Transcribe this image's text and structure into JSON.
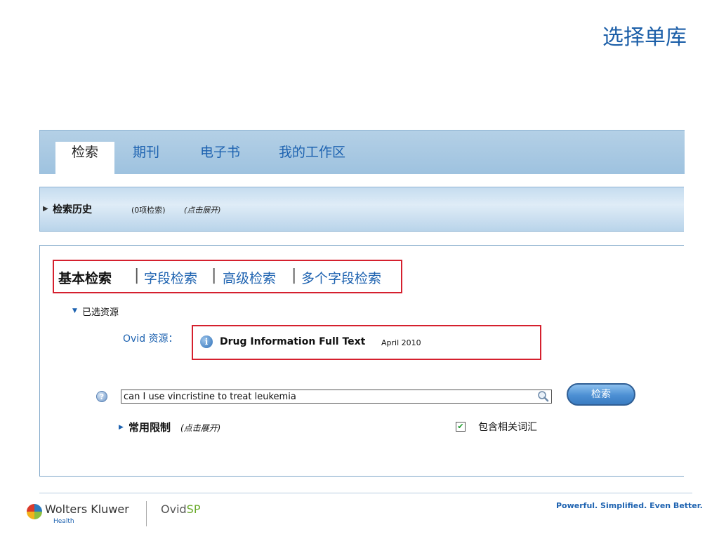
{
  "slide": {
    "title": "选择单库"
  },
  "nav": {
    "tabs": [
      {
        "label": "检索"
      },
      {
        "label": "期刊"
      },
      {
        "label": "电子书"
      },
      {
        "label": "我的工作区"
      }
    ]
  },
  "history": {
    "title": "检索历史",
    "count": "(0项检索)",
    "hint": "(点击展开)"
  },
  "search_modes": {
    "tabs": [
      {
        "label": "基本检索"
      },
      {
        "label": "字段检索"
      },
      {
        "label": "高级检索"
      },
      {
        "label": "多个字段检索"
      }
    ],
    "separator": "|"
  },
  "selected_resources": {
    "label": "已选资源",
    "ovid_label": "Ovid",
    "ovid_suffix": "资源：",
    "resource_name": "Drug Information Full Text",
    "resource_date": "April 2010"
  },
  "search": {
    "query": "can I use vincristine to treat leukemia",
    "button_label": "检索"
  },
  "limits": {
    "label": "常用限制",
    "hint": "(点击展开)"
  },
  "related_terms": {
    "label": "包含相关词汇",
    "checked": true
  },
  "footer": {
    "brand": "Wolters Kluwer",
    "brand_sub": "Health",
    "product_prefix": "Ovid",
    "product_suffix": "SP",
    "tagline": "Powerful. Simplified. Even Better."
  },
  "colors": {
    "accent_blue": "#1d62b0",
    "highlight_red": "#d5202e",
    "nav_bg": "#a9c9e3"
  }
}
